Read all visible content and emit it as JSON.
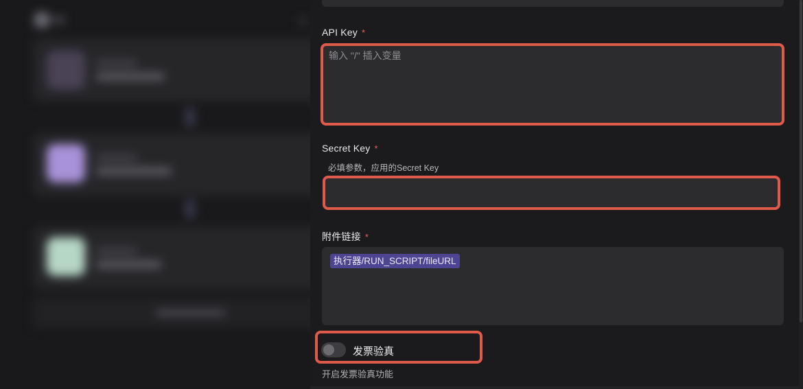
{
  "fields": {
    "api_key": {
      "label": "API Key",
      "required_mark": "*",
      "placeholder": "输入 \"/\" 插入变量",
      "value": ""
    },
    "secret_key": {
      "label": "Secret Key",
      "required_mark": "*",
      "hint": "必填参数，应用的Secret Key",
      "value": ""
    },
    "attachment_link": {
      "label": "附件链接",
      "required_mark": "*",
      "variable_chip": "执行器/RUN_SCRIPT/fileURL"
    },
    "invoice_verify": {
      "label": "发票验真",
      "description": "开启发票验真功能",
      "enabled": false
    }
  },
  "colors": {
    "highlight": "#e05a4c",
    "required": "#e5625a",
    "chip_bg": "#4e4592",
    "panel_bg": "#1b1b1d",
    "field_bg": "#2c2c2f"
  }
}
